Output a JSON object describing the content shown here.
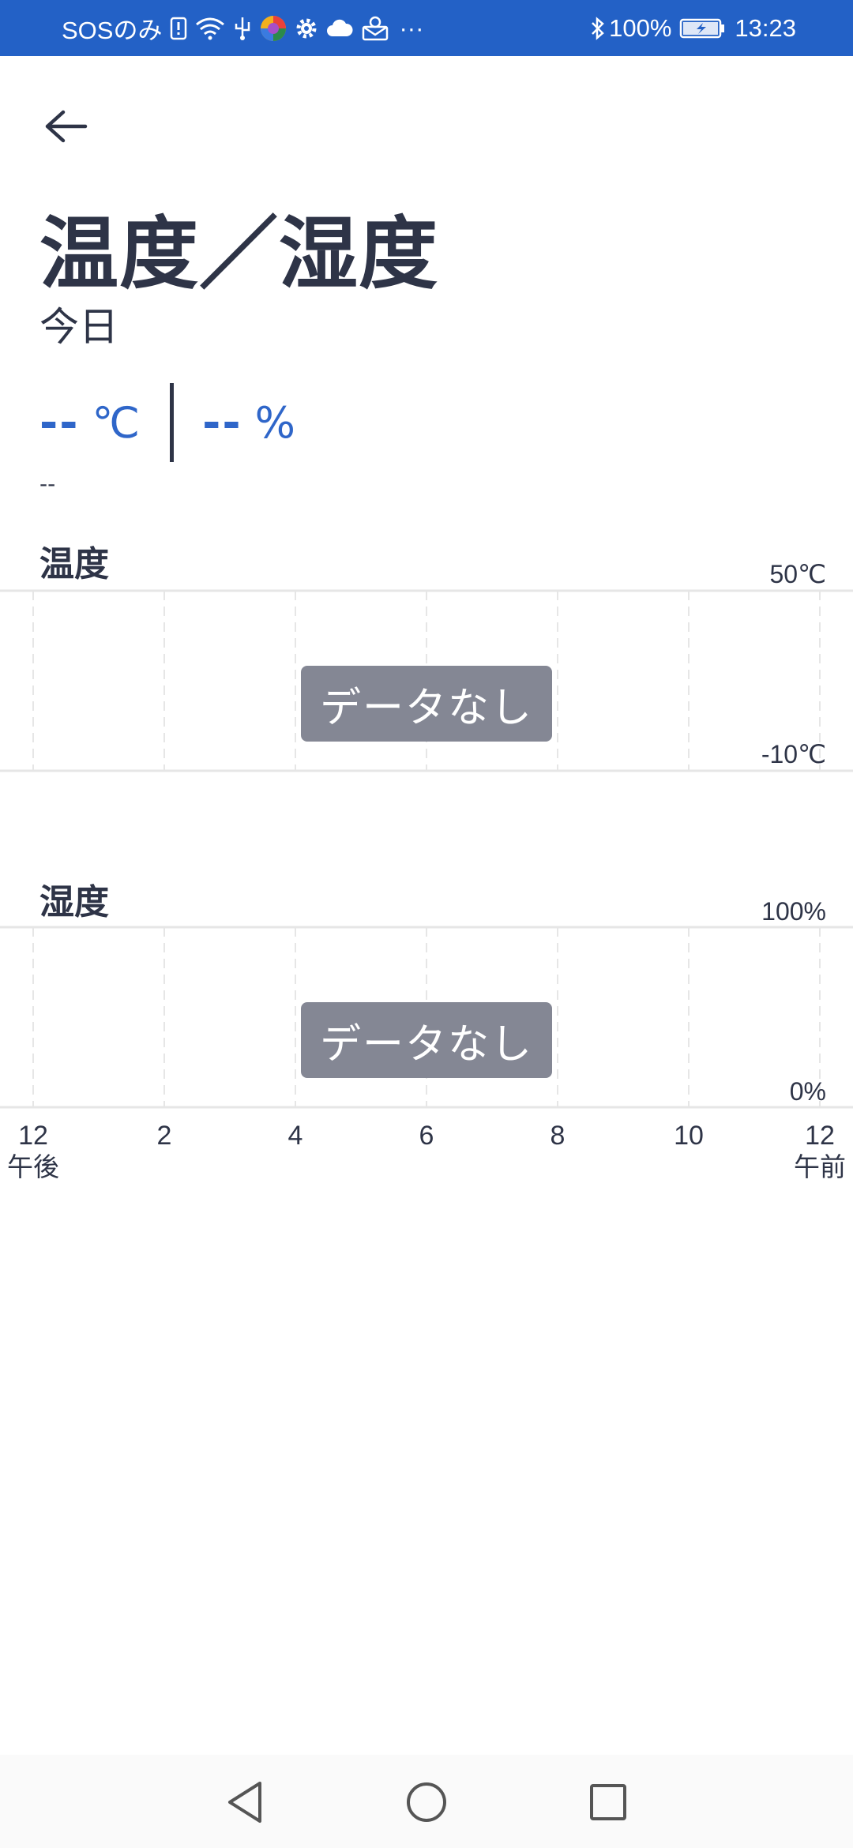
{
  "status_bar": {
    "carrier": "SOSのみ",
    "battery": "100%",
    "time": "13:23",
    "more": "···"
  },
  "header": {
    "title": "温度／湿度",
    "subtitle": "今日"
  },
  "readings": {
    "temperature_value": "--",
    "temperature_unit": "℃",
    "humidity_value": "--",
    "humidity_unit": "%",
    "time": "--"
  },
  "charts": {
    "temperature": {
      "label": "温度",
      "max_label": "50℃",
      "min_label": "-10℃",
      "empty_text": "データなし"
    },
    "humidity": {
      "label": "湿度",
      "max_label": "100%",
      "min_label": "0%",
      "empty_text": "データなし"
    }
  },
  "chart_data": [
    {
      "type": "line",
      "title": "温度",
      "x": [
        "12",
        "2",
        "4",
        "6",
        "8",
        "10",
        "12"
      ],
      "ylim": [
        -10,
        50
      ],
      "series": [],
      "annotations": [
        "データなし"
      ]
    },
    {
      "type": "line",
      "title": "湿度",
      "x": [
        "12",
        "2",
        "4",
        "6",
        "8",
        "10",
        "12"
      ],
      "ylim": [
        0,
        100
      ],
      "series": [],
      "annotations": [
        "データなし"
      ]
    }
  ],
  "x_axis": {
    "ticks": [
      "12",
      "2",
      "4",
      "6",
      "8",
      "10",
      "12"
    ],
    "start_sub": "午後",
    "end_sub": "午前"
  },
  "colors": {
    "status_bar": "#2361c6",
    "accent": "#2f66c9",
    "text": "#2e3447",
    "nodata_badge": "#848794",
    "grid": "#e6e6e6"
  },
  "icons": {
    "back": "arrow-left-icon",
    "nav_back": "triangle-back-icon",
    "nav_home": "circle-home-icon",
    "nav_recent": "square-recent-icon"
  }
}
